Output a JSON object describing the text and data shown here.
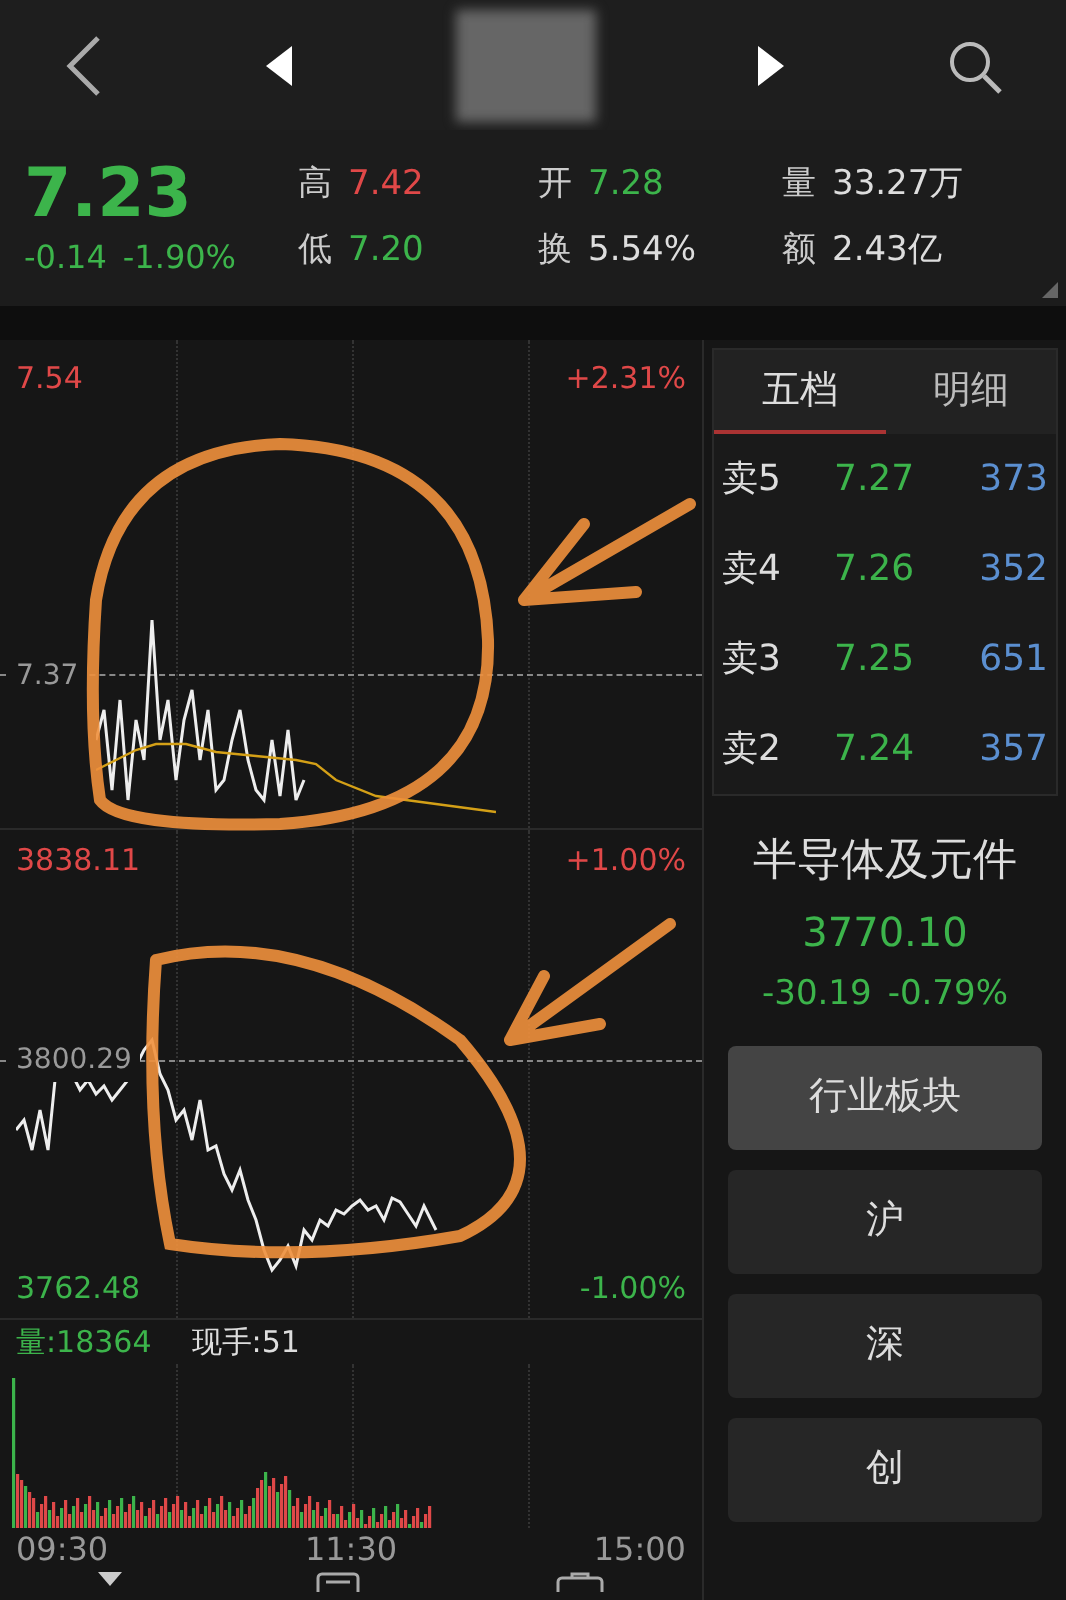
{
  "quote": {
    "price": "7.23",
    "change": "-0.14",
    "change_pct": "-1.90%",
    "stats": [
      {
        "label": "高",
        "value": "7.42",
        "color": "#e04848"
      },
      {
        "label": "开",
        "value": "7.28",
        "color": "#3cb44b"
      },
      {
        "label": "量",
        "value": "33.27万",
        "color": "#dddddd"
      },
      {
        "label": "低",
        "value": "7.20",
        "color": "#3cb44b"
      },
      {
        "label": "换",
        "value": "5.54%",
        "color": "#dddddd"
      },
      {
        "label": "额",
        "value": "2.43亿",
        "color": "#dddddd"
      }
    ]
  },
  "price_chart": {
    "high": "7.54",
    "high_pct": "+2.31%",
    "prev_close": "7.37"
  },
  "index_chart": {
    "high": "3838.11",
    "high_pct": "+1.00%",
    "prev_close": "3800.29",
    "low": "3762.48",
    "low_pct": "-1.00%"
  },
  "volume": {
    "total": "量:18364",
    "current": "现手:51"
  },
  "time_axis": [
    "09:30",
    "11:30",
    "15:00"
  ],
  "order_book": {
    "tabs": [
      {
        "label": "五档",
        "selected": true
      },
      {
        "label": "明细",
        "selected": false
      }
    ],
    "rows": [
      {
        "label": "卖5",
        "price": "7.27",
        "volume": "373"
      },
      {
        "label": "卖4",
        "price": "7.26",
        "volume": "352"
      },
      {
        "label": "卖3",
        "price": "7.25",
        "volume": "651"
      },
      {
        "label": "卖2",
        "price": "7.24",
        "volume": "357"
      }
    ]
  },
  "sector": {
    "name": "半导体及元件",
    "value": "3770.10",
    "change": "-30.19",
    "change_pct": "-0.79%"
  },
  "buttons": [
    {
      "label": "行业板块",
      "selected": true
    },
    {
      "label": "沪",
      "selected": false
    },
    {
      "label": "深",
      "selected": false
    },
    {
      "label": "创",
      "selected": false
    }
  ]
}
